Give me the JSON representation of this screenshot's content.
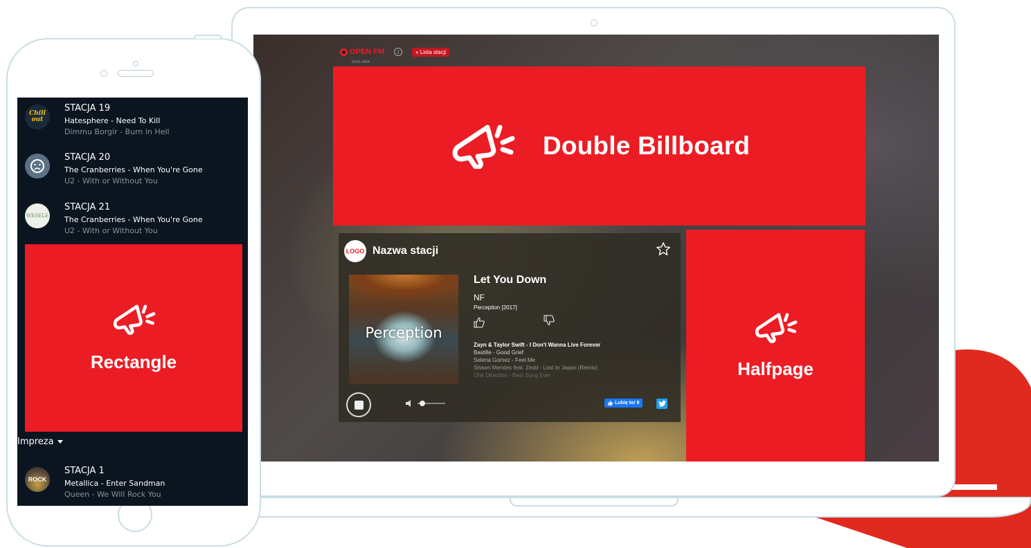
{
  "colors": {
    "accent": "#ec1c24",
    "deco_red": "#e02a1f",
    "phone_bg": "#0b1520"
  },
  "desktop": {
    "brand": "OPEN FM",
    "station_list_button": "« Lista stacji",
    "ad_label": "REKLAMA",
    "double_billboard": "Double Billboard",
    "halfpage": "Halfpage",
    "player": {
      "logo_text": "LOGO",
      "station_name": "Nazwa stacji",
      "cover_title": "Perception",
      "track_title": "Let You Down",
      "artist": "NF",
      "album": "Perception [2017]",
      "history": [
        "Zayn & Taylor Swift - I Don't Wanna Live Forever",
        "Bastille - Good Grief",
        "Selena Gomez - Feel Me",
        "Shawn Mendes feat. Zedd - Lost In Japan (Remix)",
        "One Direction - Best Song Ever"
      ],
      "like_button": "Lubię to! 9",
      "volume_level": 0.1
    }
  },
  "mobile": {
    "stations_top": [
      {
        "avatar": "Chill out",
        "name": "STACJA 19",
        "current": "Hatesphere - Need To Kill",
        "previous": "Dimmu Borgir - Burn in Hell",
        "avatar_color": "#1b2a3a"
      },
      {
        "avatar": "",
        "name": "STACJA 20",
        "current": "The Cranberries - When You're Gone",
        "previous": "U2 - With or Without You",
        "avatar_color": "#5d7186"
      },
      {
        "avatar": "WESELE",
        "name": "STACJA 21",
        "current": "The Cranberries - When You're Gone",
        "previous": "U2 - With or Without You",
        "avatar_color": "#eef1ea"
      }
    ],
    "rectangle": "Rectangle",
    "genre": "Impreza",
    "stations_bottom": [
      {
        "avatar": "ROCK",
        "name": "STACJA 1",
        "current": "Metallica - Enter Sandman",
        "previous": "Queen - We Will Rock You",
        "avatar_color": "#5a4a3a"
      }
    ]
  }
}
